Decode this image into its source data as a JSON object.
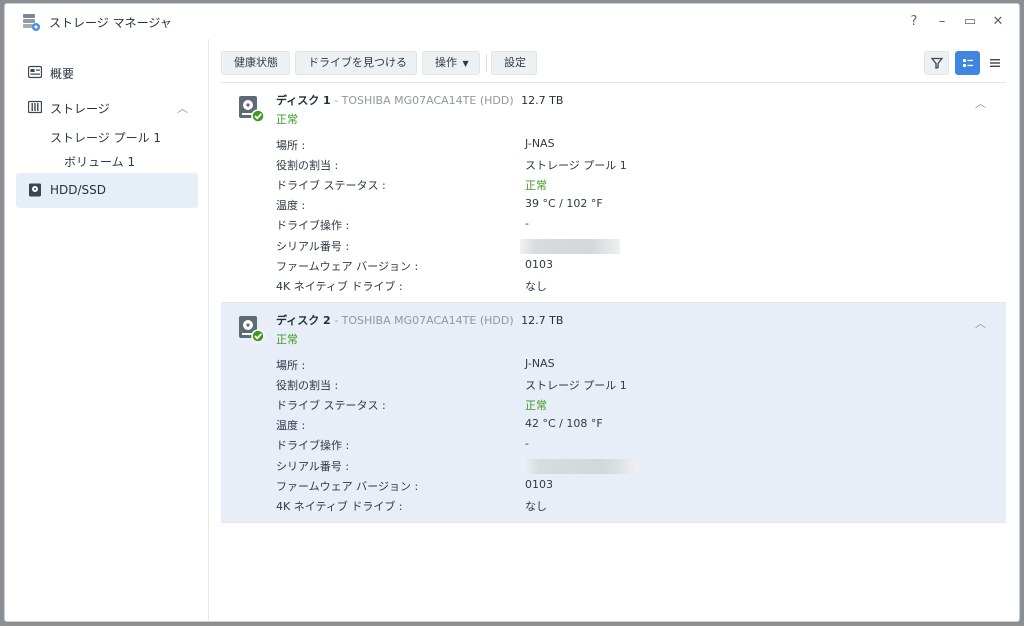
{
  "window": {
    "title": "ストレージ マネージャ",
    "controls": [
      "?",
      "–",
      "▭",
      "✕"
    ]
  },
  "sidebar": {
    "items": [
      {
        "label": "概要",
        "icon": "overview-icon"
      },
      {
        "label": "ストレージ",
        "icon": "storage-icon"
      },
      {
        "label": "ストレージ プール 1"
      },
      {
        "label": "ボリューム 1"
      },
      {
        "label": "HDD/SSD",
        "icon": "hdd-icon"
      }
    ]
  },
  "toolbar": {
    "health": "健康状態",
    "find_drive": "ドライブを見つける",
    "actions": "操作",
    "settings": "設定"
  },
  "colors": {
    "accent": "#3e86e0",
    "ok": "#3d9a22",
    "selected_bg": "#e8eef7"
  },
  "disks": [
    {
      "name": "ディスク 1",
      "model": "- TOSHIBA MG07ACA14TE (HDD)",
      "size": "12.7 TB",
      "status": "正常",
      "fields": [
        {
          "label": "場所 :",
          "value": "J-NAS"
        },
        {
          "label": "役割の割当 :",
          "value": "ストレージ プール 1"
        },
        {
          "label": "ドライブ ステータス :",
          "value": "正常"
        },
        {
          "label": "温度 :",
          "value": "39 °C / 102 °F"
        },
        {
          "label": "ドライブ操作 :",
          "value": "-"
        },
        {
          "label": "シリアル番号 :",
          "value": ""
        },
        {
          "label": "ファームウェア バージョン :",
          "value": "0103"
        },
        {
          "label": "4K ネイティブ ドライブ :",
          "value": "なし"
        }
      ]
    },
    {
      "name": "ディスク 2",
      "model": "- TOSHIBA MG07ACA14TE (HDD)",
      "size": "12.7 TB",
      "status": "正常",
      "fields": [
        {
          "label": "場所 :",
          "value": "J-NAS"
        },
        {
          "label": "役割の割当 :",
          "value": "ストレージ プール 1"
        },
        {
          "label": "ドライブ ステータス :",
          "value": "正常"
        },
        {
          "label": "温度 :",
          "value": "42 °C / 108 °F"
        },
        {
          "label": "ドライブ操作 :",
          "value": "-"
        },
        {
          "label": "シリアル番号 :",
          "value": ""
        },
        {
          "label": "ファームウェア バージョン :",
          "value": "0103"
        },
        {
          "label": "4K ネイティブ ドライブ :",
          "value": "なし"
        }
      ]
    }
  ]
}
